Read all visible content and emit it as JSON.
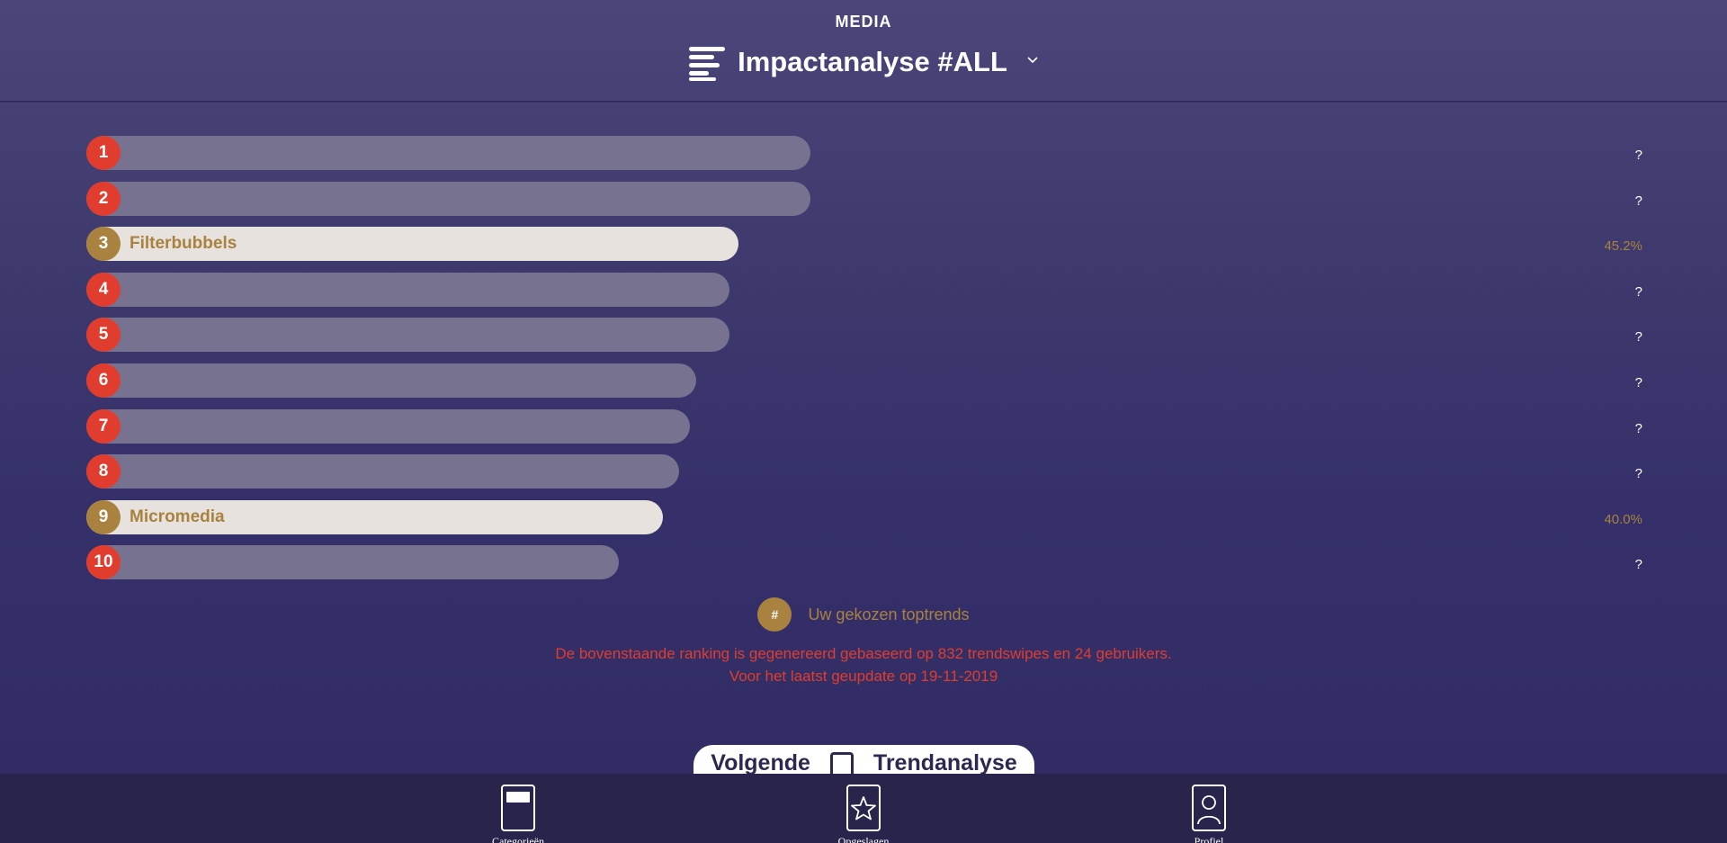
{
  "header": {
    "section": "MEDIA",
    "title": "Impactanalyse #ALL"
  },
  "ranking": [
    {
      "rank": "1",
      "name": "",
      "value": "?",
      "chosen": false,
      "bar_fraction": 0.805
    },
    {
      "rank": "2",
      "name": "",
      "value": "?",
      "chosen": false,
      "bar_fraction": 0.805
    },
    {
      "rank": "3",
      "name": "Filterbubbels",
      "value": "45.2%",
      "chosen": true,
      "bar_fraction": 0.725
    },
    {
      "rank": "4",
      "name": "",
      "value": "?",
      "chosen": false,
      "bar_fraction": 0.715
    },
    {
      "rank": "5",
      "name": "",
      "value": "?",
      "chosen": false,
      "bar_fraction": 0.715
    },
    {
      "rank": "6",
      "name": "",
      "value": "?",
      "chosen": false,
      "bar_fraction": 0.678
    },
    {
      "rank": "7",
      "name": "",
      "value": "?",
      "chosen": false,
      "bar_fraction": 0.671
    },
    {
      "rank": "8",
      "name": "",
      "value": "?",
      "chosen": false,
      "bar_fraction": 0.659
    },
    {
      "rank": "9",
      "name": "Micromedia",
      "value": "40.0%",
      "chosen": true,
      "bar_fraction": 0.641
    },
    {
      "rank": "10",
      "name": "",
      "value": "?",
      "chosen": false,
      "bar_fraction": 0.592
    }
  ],
  "legend": {
    "badge": "#",
    "text": "Uw gekozen toptrends"
  },
  "note": {
    "line1": "De bovenstaande ranking is gegenereerd gebaseerd op 832 trendswipes en 24 gebruikers.",
    "line2": "Voor het laatst geupdate op 19-11-2019"
  },
  "next_button": {
    "left": "Volgende",
    "right": "Trendanalyse"
  },
  "bottom_nav": [
    {
      "label": "Categorieën",
      "icon": "category-card-icon"
    },
    {
      "label": "Opgeslagen",
      "icon": "star-card-icon"
    },
    {
      "label": "Profiel",
      "icon": "profile-card-icon"
    }
  ],
  "colors": {
    "rank_red": "#e03d2f",
    "chosen_gold": "#a8823e",
    "bar_grey": "#76728f",
    "bar_chosen": "#e8e2de"
  }
}
